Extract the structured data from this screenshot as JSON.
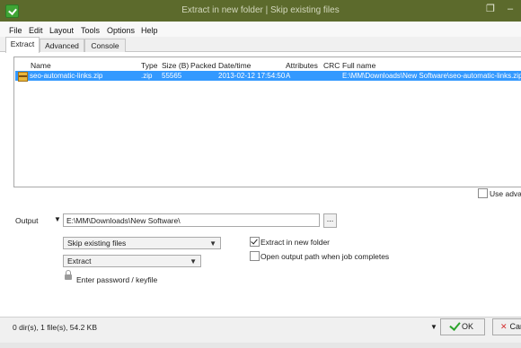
{
  "window": {
    "title": "Extract in new folder | Skip existing files",
    "restore_icon": "restore-icon",
    "minimize_label": "–"
  },
  "menu": [
    "File",
    "Edit",
    "Layout",
    "Tools",
    "Options",
    "Help"
  ],
  "tabs": [
    "Extract",
    "Advanced",
    "Console"
  ],
  "columns": [
    "Name",
    "Type",
    "Size (B)",
    "Packed",
    "Date/time",
    "Attributes",
    "CRC",
    "Full name"
  ],
  "rows": [
    {
      "name": "seo-automatic-links.zip",
      "type": ".zip",
      "size": "55565",
      "packed": "",
      "datetime": "2013-02-12 17:54:50",
      "attributes": "A",
      "crc": "",
      "fullname": "E:\\MM\\Downloads\\New Software\\seo-automatic-links.zip"
    }
  ],
  "use_advanced": {
    "label": "Use advanced",
    "checked": false
  },
  "output": {
    "label": "Output",
    "path": "E:\\MM\\Downloads\\New Software\\",
    "browse_label": "..."
  },
  "skip_mode": {
    "selected": "Skip existing files"
  },
  "action_mode": {
    "selected": "Extract"
  },
  "extract_new_folder": {
    "label": "Extract in new folder",
    "checked": true
  },
  "open_output": {
    "label": "Open output path when job completes",
    "checked": false
  },
  "password": {
    "label": "Enter password / keyfile"
  },
  "status": {
    "text": "0 dir(s), 1 file(s), 54.2 KB"
  },
  "buttons": {
    "ok": "OK",
    "cancel": "Cancel"
  },
  "colors": {
    "titlebar": "#5c6a2c",
    "selection": "#3399ff"
  }
}
